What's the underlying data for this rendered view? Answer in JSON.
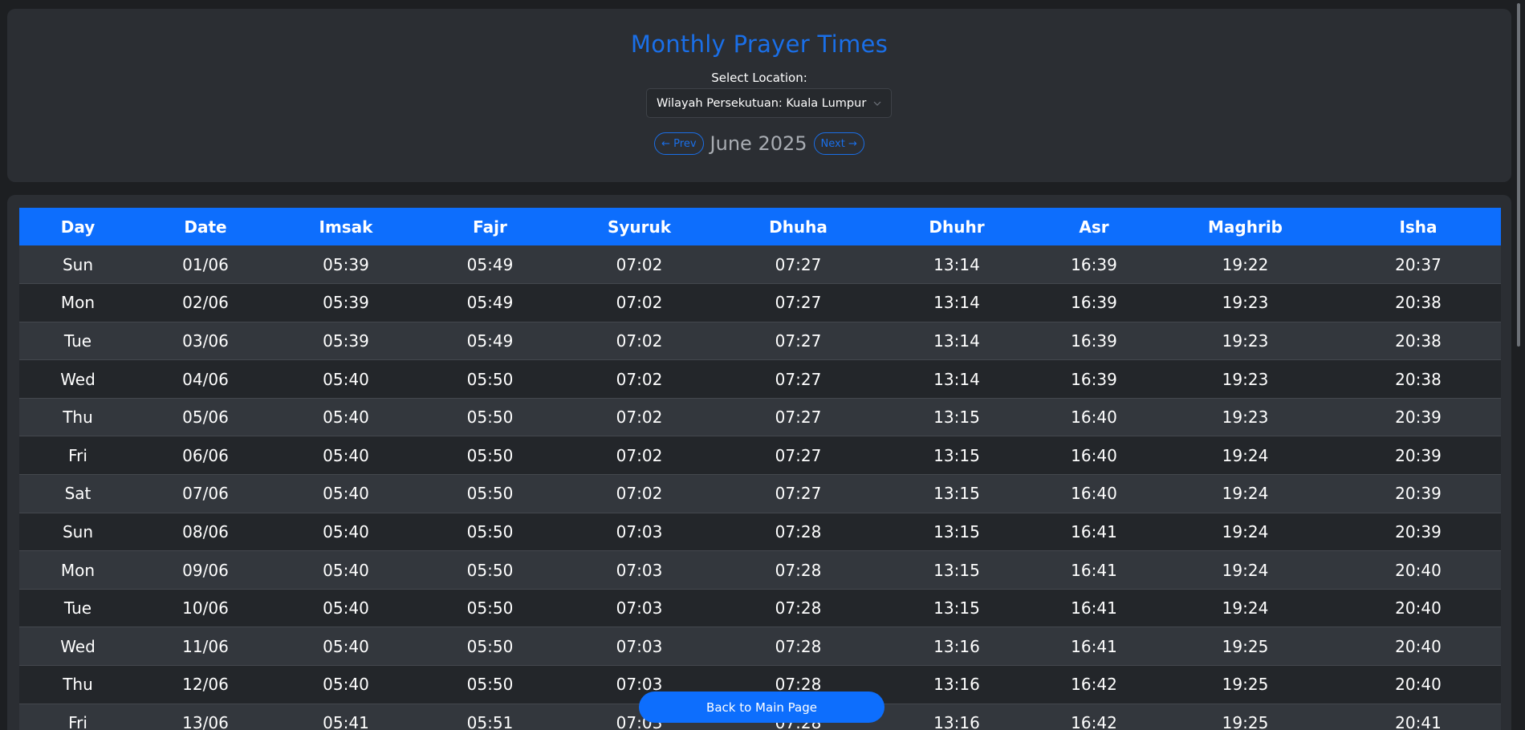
{
  "header": {
    "title": "Monthly Prayer Times",
    "location_label": "Select Location:",
    "location_value": "Wilayah Persekutuan: Kuala Lumpur",
    "prev_label": "Prev",
    "next_label": "Next",
    "month_label": "June 2025",
    "accent_color": "#1a6fe8"
  },
  "icons": {
    "prev": "arrow-left-icon",
    "next": "arrow-right-icon",
    "select": "chevron-down-icon"
  },
  "table": {
    "columns": [
      "Day",
      "Date",
      "Imsak",
      "Fajr",
      "Syuruk",
      "Dhuha",
      "Dhuhr",
      "Asr",
      "Maghrib",
      "Isha"
    ],
    "rows": [
      [
        "Sun",
        "01/06",
        "05:39",
        "05:49",
        "07:02",
        "07:27",
        "13:14",
        "16:39",
        "19:22",
        "20:37"
      ],
      [
        "Mon",
        "02/06",
        "05:39",
        "05:49",
        "07:02",
        "07:27",
        "13:14",
        "16:39",
        "19:23",
        "20:38"
      ],
      [
        "Tue",
        "03/06",
        "05:39",
        "05:49",
        "07:02",
        "07:27",
        "13:14",
        "16:39",
        "19:23",
        "20:38"
      ],
      [
        "Wed",
        "04/06",
        "05:40",
        "05:50",
        "07:02",
        "07:27",
        "13:14",
        "16:39",
        "19:23",
        "20:38"
      ],
      [
        "Thu",
        "05/06",
        "05:40",
        "05:50",
        "07:02",
        "07:27",
        "13:15",
        "16:40",
        "19:23",
        "20:39"
      ],
      [
        "Fri",
        "06/06",
        "05:40",
        "05:50",
        "07:02",
        "07:27",
        "13:15",
        "16:40",
        "19:24",
        "20:39"
      ],
      [
        "Sat",
        "07/06",
        "05:40",
        "05:50",
        "07:02",
        "07:27",
        "13:15",
        "16:40",
        "19:24",
        "20:39"
      ],
      [
        "Sun",
        "08/06",
        "05:40",
        "05:50",
        "07:03",
        "07:28",
        "13:15",
        "16:41",
        "19:24",
        "20:39"
      ],
      [
        "Mon",
        "09/06",
        "05:40",
        "05:50",
        "07:03",
        "07:28",
        "13:15",
        "16:41",
        "19:24",
        "20:40"
      ],
      [
        "Tue",
        "10/06",
        "05:40",
        "05:50",
        "07:03",
        "07:28",
        "13:15",
        "16:41",
        "19:24",
        "20:40"
      ],
      [
        "Wed",
        "11/06",
        "05:40",
        "05:50",
        "07:03",
        "07:28",
        "13:16",
        "16:41",
        "19:25",
        "20:40"
      ],
      [
        "Thu",
        "12/06",
        "05:40",
        "05:50",
        "07:03",
        "07:28",
        "13:16",
        "16:42",
        "19:25",
        "20:40"
      ],
      [
        "Fri",
        "13/06",
        "05:41",
        "05:51",
        "07:03",
        "07:28",
        "13:16",
        "16:42",
        "19:25",
        "20:41"
      ]
    ]
  },
  "footer": {
    "back_label": "Back to Main Page"
  }
}
